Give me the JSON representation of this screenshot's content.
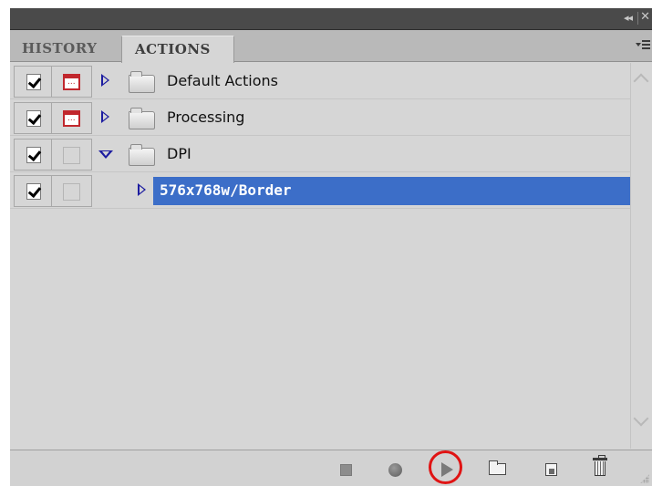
{
  "window": {
    "collapse_glyph": "◂◂",
    "close_glyph": "✕"
  },
  "tabs": [
    {
      "label": "HISTORY",
      "active": false
    },
    {
      "label": "ACTIONS",
      "active": true
    }
  ],
  "actions": [
    {
      "label": "Default Actions",
      "enabled": true,
      "dialog": true,
      "expanded": false,
      "type": "set"
    },
    {
      "label": "Processing",
      "enabled": true,
      "dialog": true,
      "expanded": false,
      "type": "set"
    },
    {
      "label": "DPI",
      "enabled": true,
      "dialog": false,
      "expanded": true,
      "type": "set"
    },
    {
      "label": "576x768w/Border",
      "enabled": true,
      "dialog": false,
      "expanded": false,
      "type": "action",
      "selected": true
    }
  ],
  "toolbar": {
    "buttons": [
      {
        "name": "stop-playing-button",
        "icon": "stop-icon"
      },
      {
        "name": "begin-recording-button",
        "icon": "record-icon"
      },
      {
        "name": "play-selection-button",
        "icon": "play-icon",
        "highlighted": true
      },
      {
        "name": "create-new-set-button",
        "icon": "folder-icon"
      },
      {
        "name": "create-new-action-button",
        "icon": "new-action-icon"
      },
      {
        "name": "delete-button",
        "icon": "trash-icon"
      }
    ]
  },
  "colors": {
    "selection": "#3c6ec8",
    "expand_triangle": "#1c1ca0",
    "dialog_toggle": "#c1272d",
    "highlight_ring": "#e01414"
  }
}
